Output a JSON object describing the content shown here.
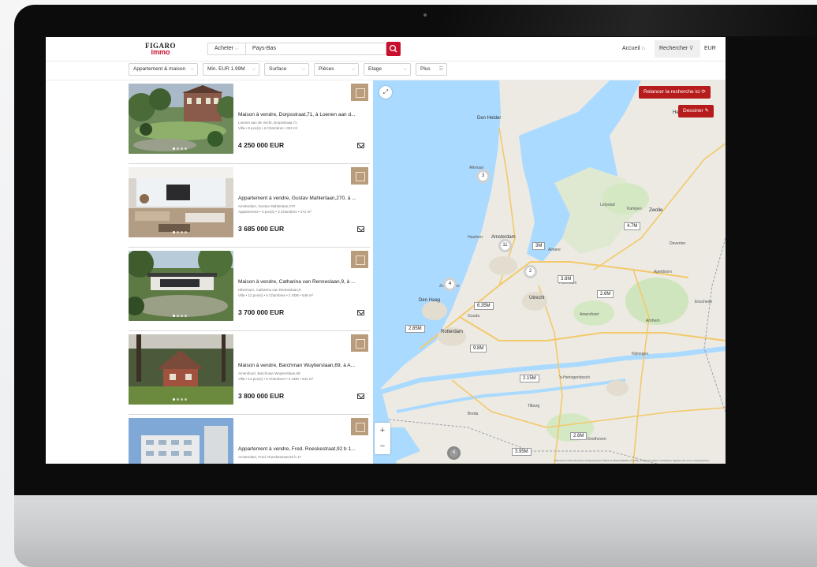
{
  "header": {
    "logo_top": "FIGARO",
    "logo_bottom": "immo",
    "transaction_select": "Acheter",
    "search_value": "Pays-Bas",
    "nav": {
      "home": "Accueil",
      "search": "Rechercher",
      "currency": "EUR"
    }
  },
  "filters": {
    "type": "Appartement & maison",
    "price": "Min. EUR 1.99M",
    "surface": "Surface",
    "rooms": "Pièces",
    "floor": "Etage",
    "more": "Plus"
  },
  "listings": [
    {
      "title": "Maison à vendre, Dorpsstraat,71, à Loenen aan d...",
      "address": "Loenen aan de Vecht, Dorpsstraat,71",
      "specs": "Villa • 9 pce(s) • 6 Chambres • 322 m²",
      "price": "4 250 000 EUR"
    },
    {
      "title": "Appartement à vendre, Gustav Mahlerlaan,270, à ...",
      "address": "Amsterdam, Gustav Mahlerlaan,270",
      "specs": "Appartement • 4 pce(s) • 3 Chambres • 271 m²",
      "price": "3 685 000 EUR"
    },
    {
      "title": "Maison à vendre, Catharina van Renneslaan,9, à ...",
      "address": "Hilversum, Catharina van Renneslaan,9",
      "specs": "Villa • 12 pce(s) • 6 Chambres • 2 SDB • 548 m²",
      "price": "3 700 000 EUR"
    },
    {
      "title": "Maison à vendre, Barchman Wuytierslaan,69, à A...",
      "address": "Amersfoort, Barchman Wuytierslaan,69",
      "specs": "Villa • 13 pce(s) • 5 Chambres • 3 SDB • 543 m²",
      "price": "3 800 000 EUR"
    },
    {
      "title": "Appartement à vendre, Fred. Roeskestraat,92 b 1...",
      "address": "Amsterdam, Fred. Roeskestraat,92 b 17",
      "specs": "",
      "price": ""
    }
  ],
  "map": {
    "relaunch_button": "Relancer la recherche ici",
    "draw_button": "Dessiner",
    "zoom_in": "+",
    "zoom_out": "−",
    "clusters": [
      "3",
      "11",
      "2",
      "4",
      "4"
    ],
    "price_tags": [
      "3M",
      "4.7M",
      "3.8M",
      "2.6M",
      "6.35M",
      "2.85M",
      "9.8M",
      "2.15M",
      "2.6M",
      "3.95M"
    ],
    "places": [
      "Den Helder",
      "Heerenveen",
      "Alkmaar",
      "Lelystad",
      "Zwolle",
      "Haarlem",
      "Amsterdam",
      "Almere",
      "Apeldoorn",
      "Den Haag",
      "Rotterdam",
      "Utrecht",
      "Arnhem",
      "Nijmegen",
      "Tilburg",
      "Eindhoven",
      "'s-Hertogenbosch",
      "Breda",
      "Kampen",
      "Deventer",
      "Gouda",
      "Zoetermeer",
      "Hilversum",
      "Amersfoort",
      "Enschede"
    ],
    "attribution": "Raccourcis clavier  Données cartographiques ©2021 GeoBasis-DE/BKG (©2009), Google  Conditions d'utilisation  Signaler une erreur cartographique"
  },
  "colors": {
    "brand_red": "#c8102e",
    "map_button_red": "#b71c1c",
    "agency_badge": "#b99c7b"
  }
}
